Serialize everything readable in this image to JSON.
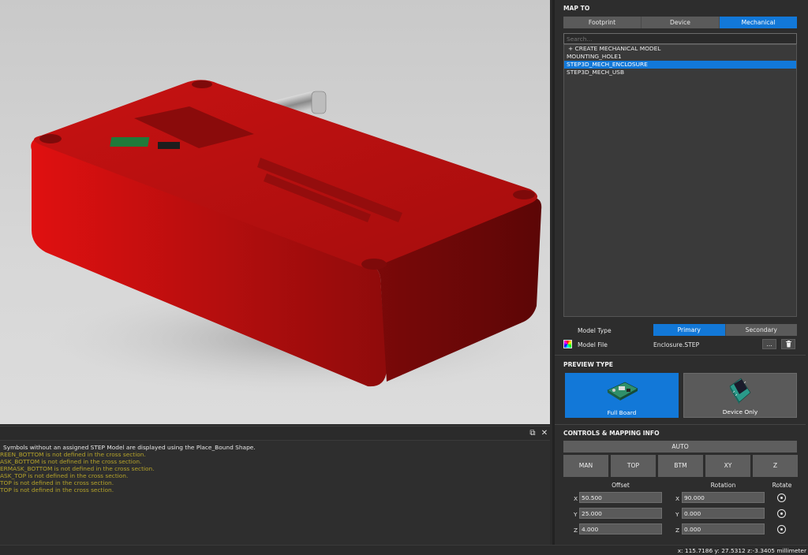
{
  "colors": {
    "accent": "#1278d8",
    "enclosure": "#b80f0f",
    "warning_text": "#b5a32a"
  },
  "map_to": {
    "title": "MAP TO",
    "tabs": [
      {
        "label": "Footprint",
        "active": false
      },
      {
        "label": "Device",
        "active": false
      },
      {
        "label": "Mechanical",
        "active": true
      }
    ],
    "search_placeholder": "Search...",
    "items": [
      {
        "label": "+ CREATE MECHANICAL MODEL",
        "selected": false
      },
      {
        "label": "MOUNTING_HOLE1",
        "selected": false
      },
      {
        "label": "STEP3D_MECH_ENCLOSURE",
        "selected": true
      },
      {
        "label": "STEP3D_MECH_USB",
        "selected": false
      }
    ]
  },
  "model": {
    "type_label": "Model Type",
    "type_options": [
      {
        "label": "Primary",
        "active": true
      },
      {
        "label": "Secondary",
        "active": false
      }
    ],
    "file_label": "Model File",
    "file_icon": "color-wheel-icon",
    "file_value": "Enclosure.STEP",
    "browse_label": "...",
    "delete_icon": "trash-icon"
  },
  "preview": {
    "title": "PREVIEW TYPE",
    "options": [
      {
        "label": "Full Board",
        "active": true,
        "icon": "full-board-icon"
      },
      {
        "label": "Device Only",
        "active": false,
        "icon": "device-chip-icon"
      }
    ]
  },
  "controls": {
    "title": "CONTROLS & MAPPING INFO",
    "auto_label": "AUTO",
    "buttons": [
      "MAN",
      "TOP",
      "BTM",
      "XY",
      "Z"
    ],
    "offset_label": "Offset",
    "rotation_label": "Rotation",
    "rotate_label": "Rotate",
    "offset": {
      "x": "50.500",
      "y": "25.000",
      "z": "4.000"
    },
    "rotation": {
      "x": "90.000",
      "y": "0.000",
      "z": "0.000"
    },
    "axis_labels": {
      "x": "X",
      "y": "Y",
      "z": "Z"
    }
  },
  "console": {
    "lines": [
      {
        "text": "Symbols without an assigned STEP Model are displayed using the Place_Bound Shape.",
        "kind": "info"
      },
      {
        "text": "REEN_BOTTOM is not defined in the cross section.",
        "kind": "warn"
      },
      {
        "text": "ASK_BOTTOM is not defined in the cross section.",
        "kind": "warn"
      },
      {
        "text": "ERMASK_BOTTOM is not defined in the cross section.",
        "kind": "warn"
      },
      {
        "text": "ASK_TOP is not defined in the cross section.",
        "kind": "warn"
      },
      {
        "text": "TOP is not defined in the cross section.",
        "kind": "warn"
      },
      {
        "text": "TOP is not defined in the cross section.",
        "kind": "warn"
      }
    ]
  },
  "status": {
    "coordinates": "x: 115.7186 y: 27.5312 z:-3.3405 millimeter"
  }
}
